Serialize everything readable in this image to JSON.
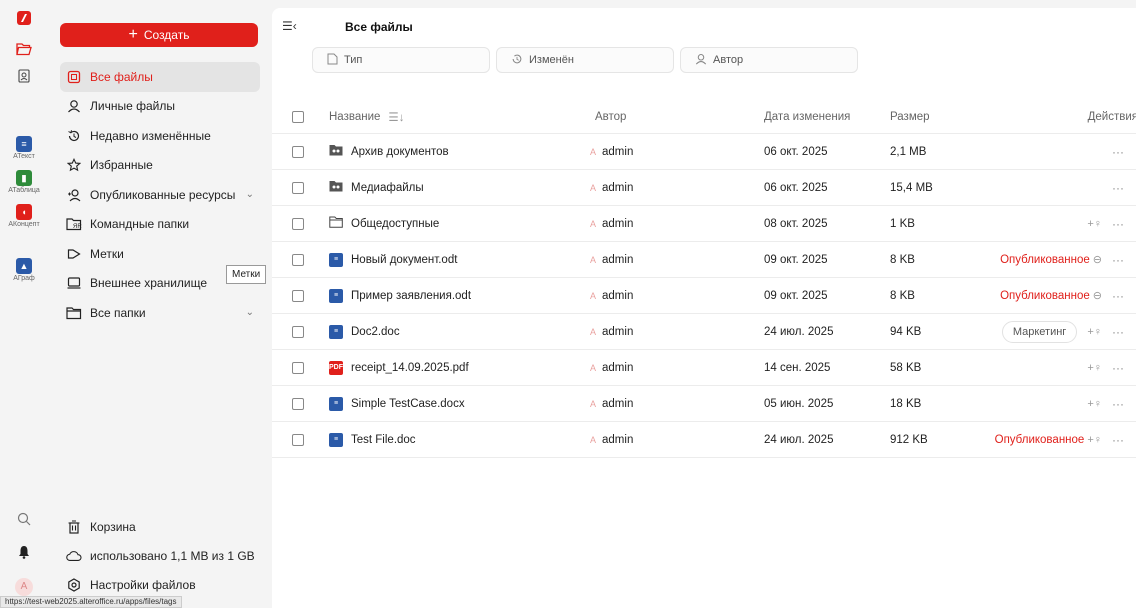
{
  "rail": {
    "items": [
      {
        "name": "АТекст",
        "color": "#2b5aa8",
        "glyph": "≡"
      },
      {
        "name": "АТаблица",
        "color": "#2e8b3a",
        "glyph": "▮"
      },
      {
        "name": "АКонцепт",
        "color": "#e0201b",
        "glyph": "◖"
      },
      {
        "name": "АГраф",
        "color": "#2b5aa8",
        "glyph": "▲"
      }
    ],
    "avatar": "A"
  },
  "sidebar": {
    "create_label": "Создать",
    "items": [
      {
        "label": "Все файлы",
        "icon": "all-files-icon",
        "active": true
      },
      {
        "label": "Личные файлы",
        "icon": "person-icon"
      },
      {
        "label": "Недавно изменённые",
        "icon": "history-icon"
      },
      {
        "label": "Избранные",
        "icon": "star-icon"
      },
      {
        "label": "Опубликованные ресурсы",
        "icon": "share-icon",
        "chevron": true
      },
      {
        "label": "Командные папки",
        "icon": "team-folder-icon"
      },
      {
        "label": "Метки",
        "icon": "tag-icon"
      },
      {
        "label": "Внешнее хранилище",
        "icon": "external-storage-icon"
      },
      {
        "label": "Все папки",
        "icon": "folder-icon",
        "chevron": true
      }
    ],
    "tooltip": "Метки",
    "trash": "Корзина",
    "usage": "использовано 1,1 MB из 1 GB",
    "settings": "Настройки файлов"
  },
  "main": {
    "title": "Все файлы",
    "filters": [
      {
        "label": "Тип",
        "icon": "file-icon"
      },
      {
        "label": "Изменён",
        "icon": "history-icon"
      },
      {
        "label": "Автор",
        "icon": "person-icon"
      }
    ],
    "columns": {
      "name": "Название",
      "author": "Автор",
      "date": "Дата изменения",
      "size": "Размер",
      "actions": "Действия"
    },
    "rows": [
      {
        "name": "Архив документов",
        "type": "group-folder",
        "author": "admin",
        "date": "06 окт. 2025",
        "size": "2,1 MB",
        "extra": ""
      },
      {
        "name": "Медиафайлы",
        "type": "group-folder",
        "author": "admin",
        "date": "06 окт. 2025",
        "size": "15,4 MB",
        "extra": ""
      },
      {
        "name": "Общедоступные",
        "type": "folder",
        "author": "admin",
        "date": "08 окт. 2025",
        "size": "1 KB",
        "extra": "share"
      },
      {
        "name": "Новый документ.odt",
        "type": "doc",
        "author": "admin",
        "date": "09 окт. 2025",
        "size": "8 KB",
        "extra": "published-link",
        "status": "Опубликованное"
      },
      {
        "name": "Пример заявления.odt",
        "type": "doc",
        "author": "admin",
        "date": "09 окт. 2025",
        "size": "8 KB",
        "extra": "published-link",
        "status": "Опубликованное"
      },
      {
        "name": "Doc2.doc",
        "type": "doc",
        "author": "admin",
        "date": "24 июл. 2025",
        "size": "94 KB",
        "extra": "tag-share",
        "tag": "Маркетинг"
      },
      {
        "name": "receipt_14.09.2025.pdf",
        "type": "pdf",
        "author": "admin",
        "date": "14 сен. 2025",
        "size": "58 KB",
        "extra": "share"
      },
      {
        "name": "Simple TestCase.docx",
        "type": "doc",
        "author": "admin",
        "date": "05 июн. 2025",
        "size": "18 KB",
        "extra": "share"
      },
      {
        "name": "Test File.doc",
        "type": "doc",
        "author": "admin",
        "date": "24 июл. 2025",
        "size": "912 KB",
        "extra": "published-share",
        "status": "Опубликованное"
      }
    ]
  },
  "statusbar": "https://test-web2025.alteroffice.ru/apps/files/tags"
}
